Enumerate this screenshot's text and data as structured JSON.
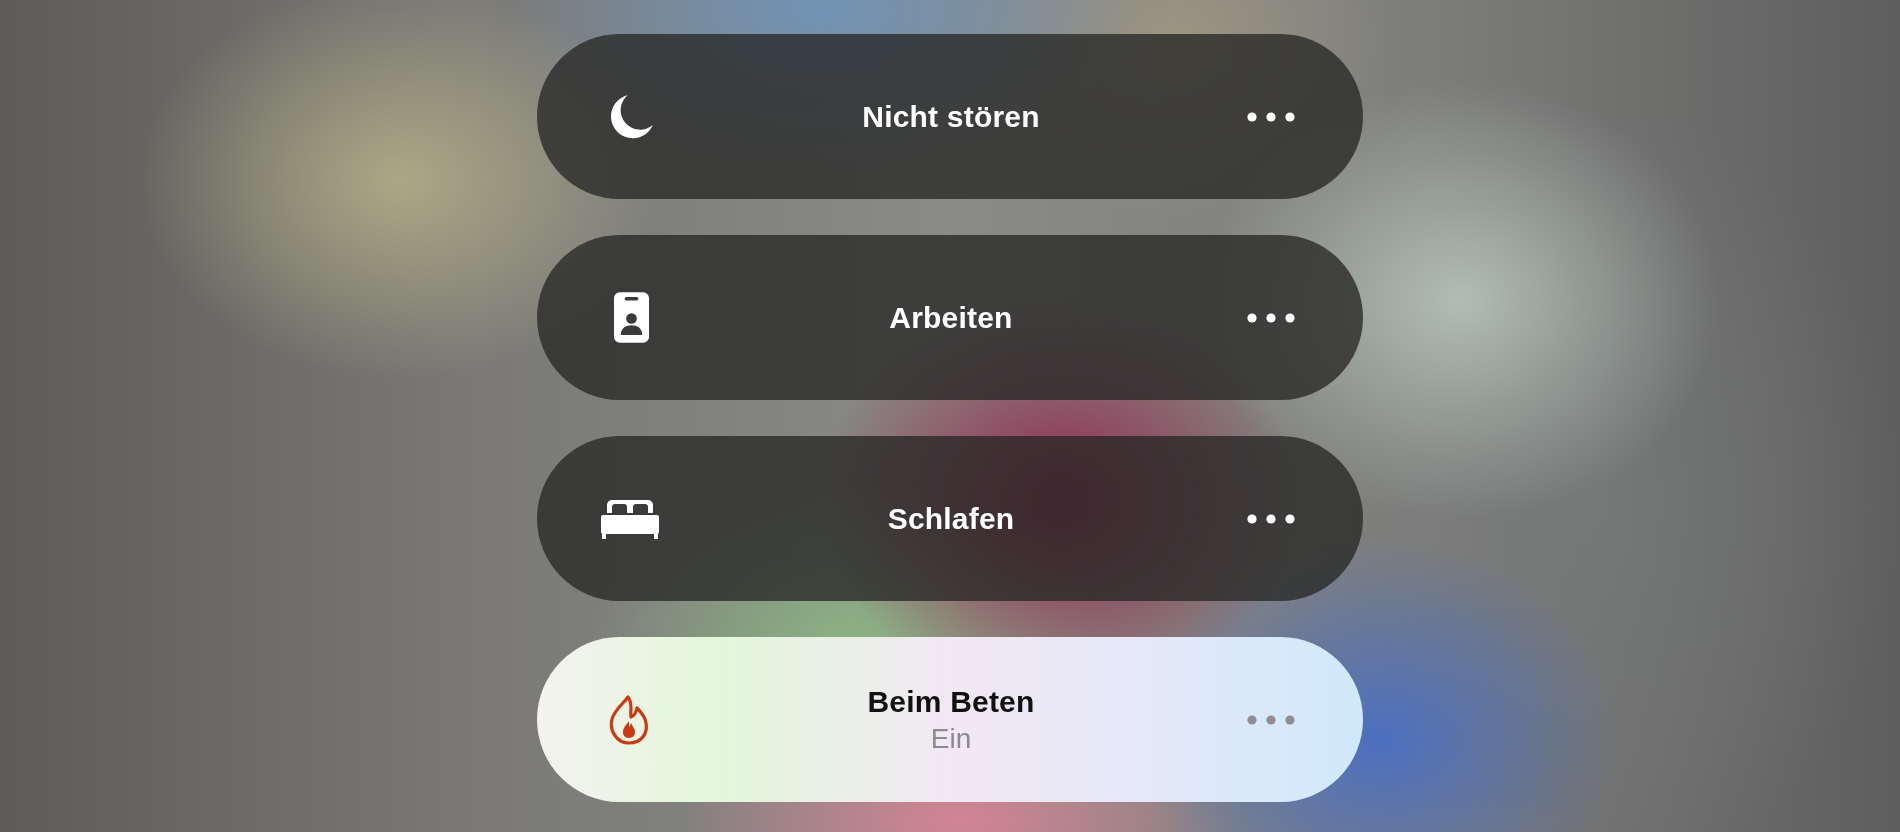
{
  "modes": [
    {
      "kind": "moon",
      "label": "Nicht stören",
      "selected": false
    },
    {
      "kind": "badge",
      "label": "Arbeiten",
      "selected": false
    },
    {
      "kind": "bed",
      "label": "Schlafen",
      "selected": false
    },
    {
      "kind": "flame",
      "label": "Beim Beten",
      "status": "Ein",
      "selected": true
    }
  ]
}
